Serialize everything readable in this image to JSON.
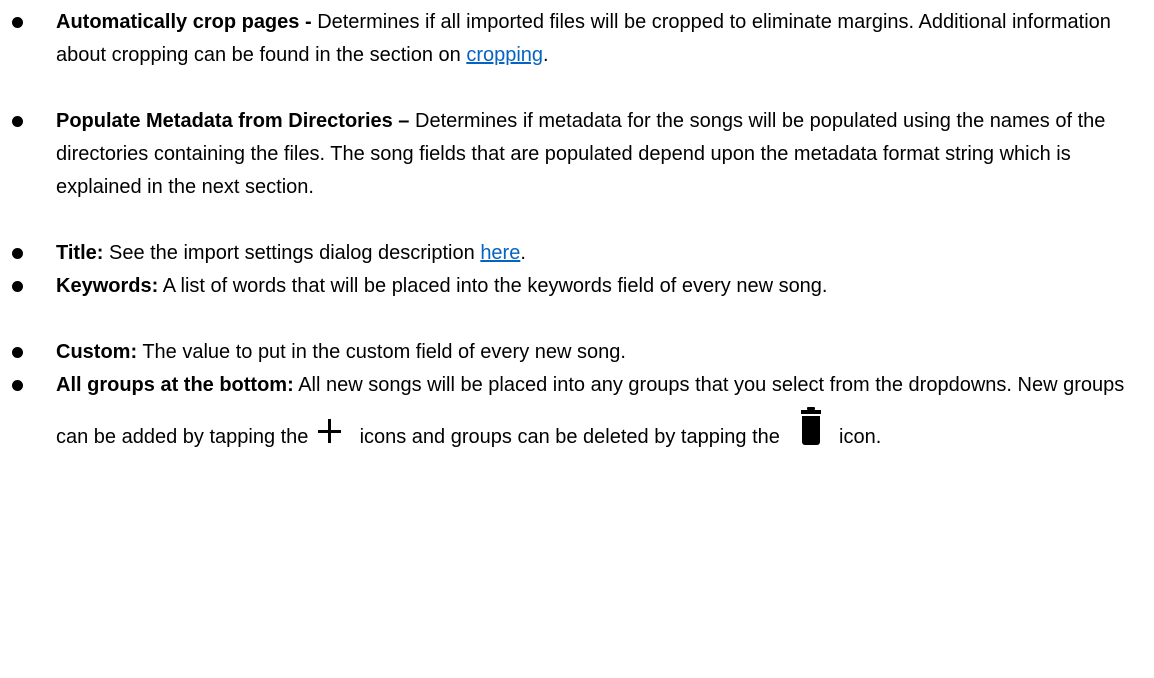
{
  "colors": {
    "text": "#000000",
    "link": "#0563C1",
    "background": "#ffffff"
  },
  "items": [
    {
      "term": "Automatically crop pages -",
      "desc": "Determines if all imported files will be cropped to eliminate margins.  Additional information about cropping can be found in the section on",
      "link": "cropping",
      "after": "."
    },
    {
      "term": "Populate Metadata from Directories –",
      "desc": "Determines if metadata for the songs will be populated using the names of the directories containing the files. The song fields that are populated depend upon the metadata format string which is explained in the next section."
    },
    {
      "term": "Title:",
      "desc": "See the import settings dialog description",
      "link": "here",
      "after": "."
    },
    {
      "term": "Keywords:",
      "desc": "A list of words that will be placed into the keywords field of every new song."
    },
    {
      "term": "Custom:",
      "desc": "The value to put in the custom field of every new song."
    },
    {
      "term": "All groups at the bottom:",
      "desc_before_plus": "All new songs will be placed into any groups that you select from the dropdowns. New groups can be added by tapping the",
      "desc_between_icons": "icons and groups can be deleted by tapping the",
      "desc_end": "icon.",
      "plus_icon": "plus-icon",
      "trash_icon": "trash-icon"
    }
  ]
}
